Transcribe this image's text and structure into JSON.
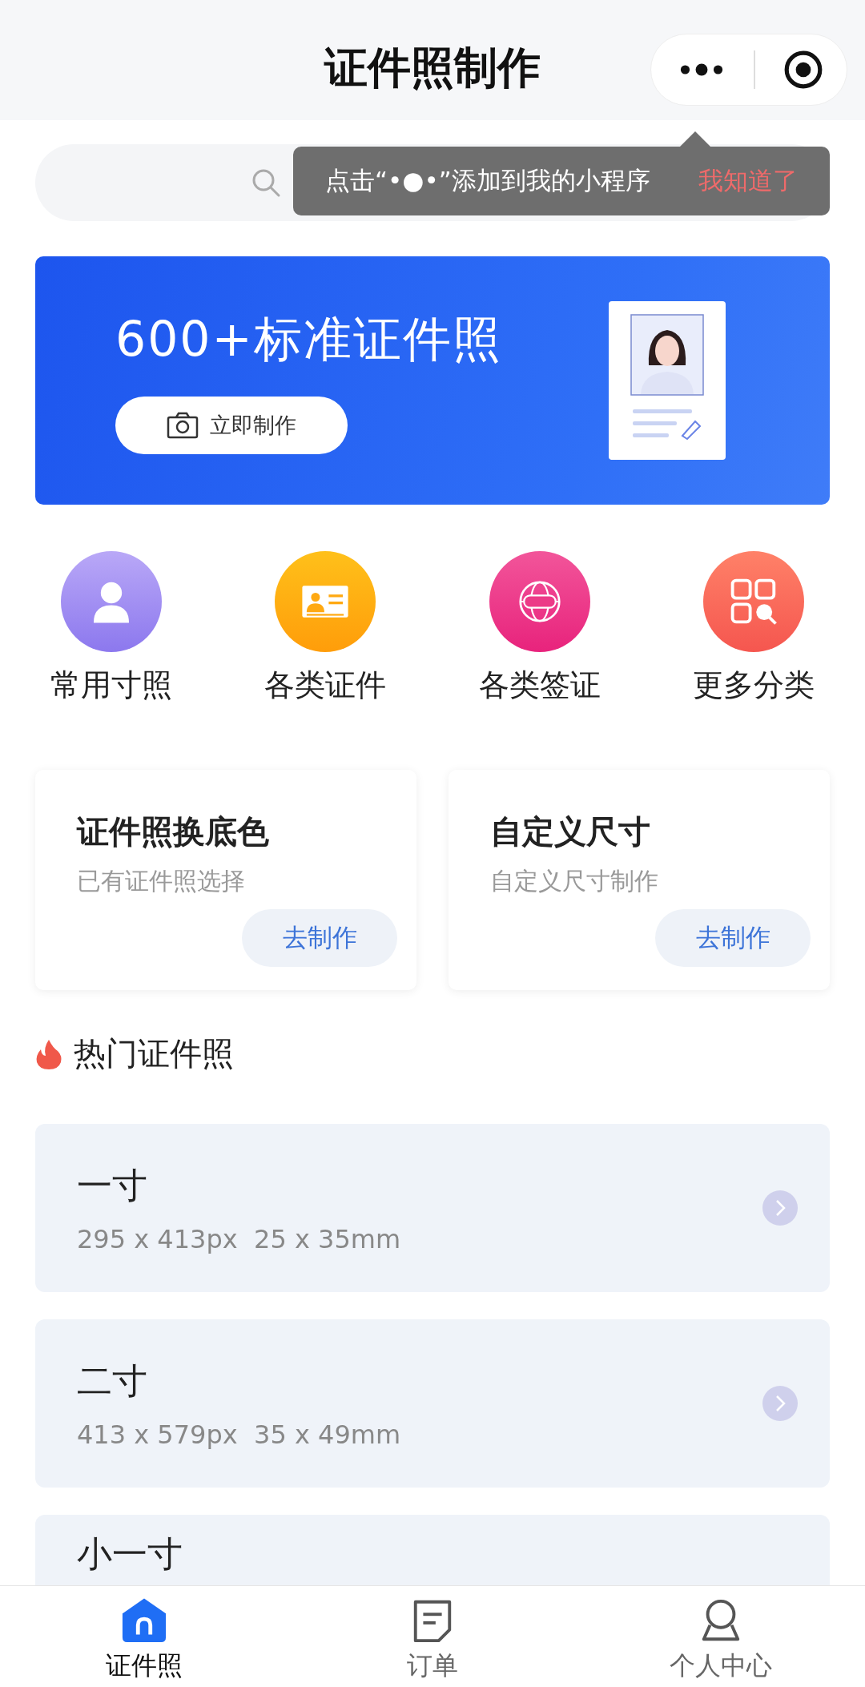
{
  "header": {
    "title": "证件照制作"
  },
  "tooltip": {
    "text": "点击“•●•”添加到我的小程序",
    "action": "我知道了"
  },
  "banner": {
    "title": "600+标准证件照",
    "button": "立即制作"
  },
  "categories": [
    {
      "label": "常用寸照",
      "kind": "person"
    },
    {
      "label": "各类证件",
      "kind": "id-card"
    },
    {
      "label": "各类签证",
      "kind": "passport"
    },
    {
      "label": "更多分类",
      "kind": "grid"
    }
  ],
  "tools": [
    {
      "title": "证件照换底色",
      "subtitle": "已有证件照选择",
      "button": "去制作"
    },
    {
      "title": "自定义尺寸",
      "subtitle": "自定义尺寸制作",
      "button": "去制作"
    }
  ],
  "hot": {
    "title": "热门证件照",
    "items": [
      {
        "name": "一寸",
        "spec": "295 x 413px  25 x 35mm"
      },
      {
        "name": "二寸",
        "spec": "413 x 579px  35 x 49mm"
      },
      {
        "name": "小一寸"
      }
    ]
  },
  "tabbar": [
    {
      "label": "证件照",
      "kind": "home",
      "selected": true
    },
    {
      "label": "订单",
      "kind": "order",
      "selected": false
    },
    {
      "label": "个人中心",
      "kind": "person",
      "selected": false
    }
  ]
}
